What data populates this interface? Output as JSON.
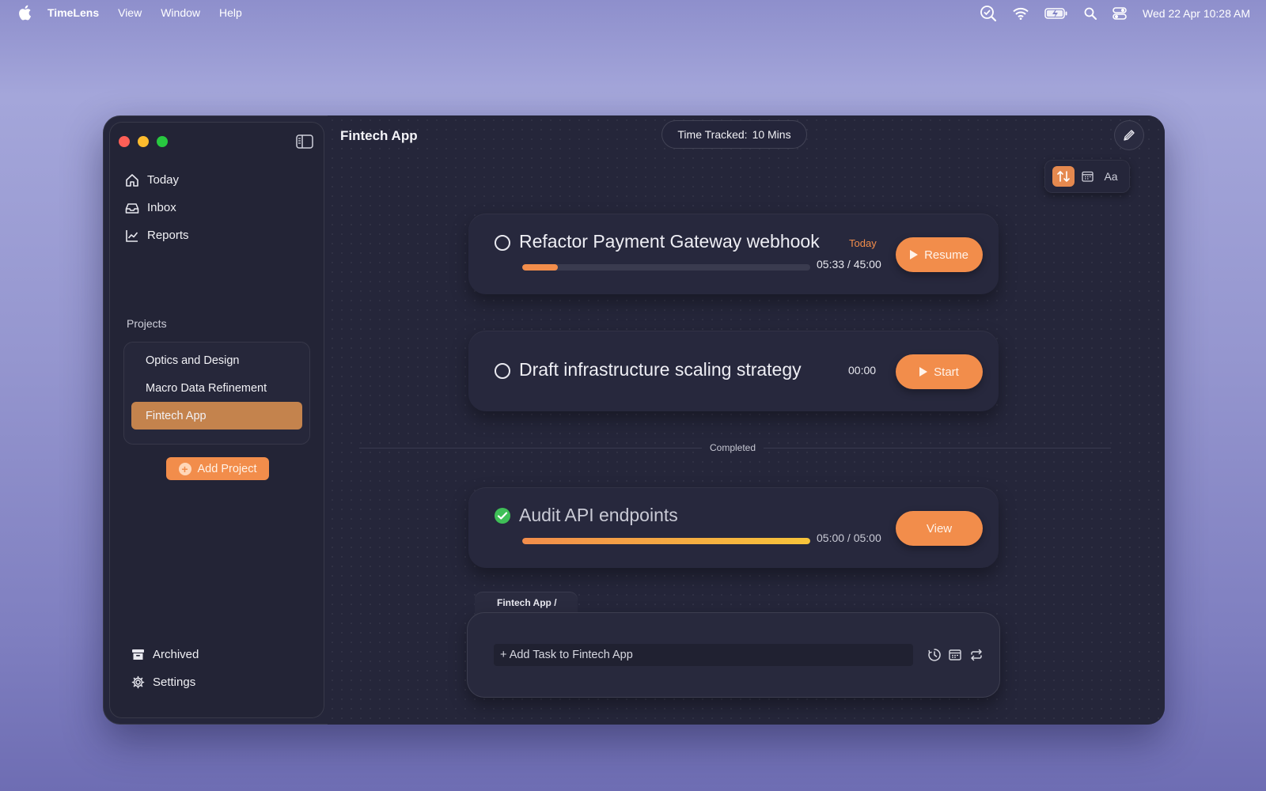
{
  "menubar": {
    "app_name": "TimeLens",
    "menus": [
      "View",
      "Window",
      "Help"
    ],
    "clock": "Wed 22 Apr  10:28 AM",
    "status_icons": [
      "timelens-status-icon",
      "wifi-icon",
      "battery-charging-icon",
      "spotlight-search-icon",
      "control-center-icon"
    ]
  },
  "sidebar": {
    "nav": [
      {
        "label": "Today",
        "icon": "home-icon"
      },
      {
        "label": "Inbox",
        "icon": "inbox-icon"
      },
      {
        "label": "Reports",
        "icon": "chart-icon"
      }
    ],
    "projects_label": "Projects",
    "projects": [
      {
        "label": "Optics and Design",
        "active": false
      },
      {
        "label": "Macro Data Refinement",
        "active": false
      },
      {
        "label": "Fintech App",
        "active": true
      }
    ],
    "add_project_label": "Add Project",
    "bottom": [
      {
        "label": "Archived",
        "icon": "archive-icon"
      },
      {
        "label": "Settings",
        "icon": "gear-icon"
      }
    ]
  },
  "main": {
    "title": "Fintech App",
    "time_tracked_label": "Time Tracked:",
    "time_tracked_value": "10 Mins",
    "view_toggles": [
      "sort-icon",
      "calendar-icon",
      "Aa"
    ],
    "active_toggle": 0,
    "completed_label": "Completed",
    "tasks": [
      {
        "title": "Refactor Payment Gateway webhook",
        "due": "Today",
        "timer": "05:33 / 45:00",
        "progress": 0.123,
        "action": "Resume",
        "done": false
      },
      {
        "title": "Draft infrastructure scaling strategy",
        "timer": "00:00",
        "action": "Start",
        "done": false
      },
      {
        "title": "Audit API endpoints",
        "timer": "05:00 / 05:00",
        "progress": 1.0,
        "action": "View",
        "done": true
      }
    ],
    "composer": {
      "tab_label": "Fintech App /",
      "placeholder": "+ Add Task to Fintech App",
      "icons": [
        "timer-icon",
        "calendar-icon",
        "repeat-icon"
      ]
    }
  },
  "colors": {
    "accent": "#f28d4b",
    "active_project": "#c4834d",
    "progress_start": "#f28d4b",
    "progress_end": "#f7c43a",
    "done_check": "#3fbf57"
  }
}
